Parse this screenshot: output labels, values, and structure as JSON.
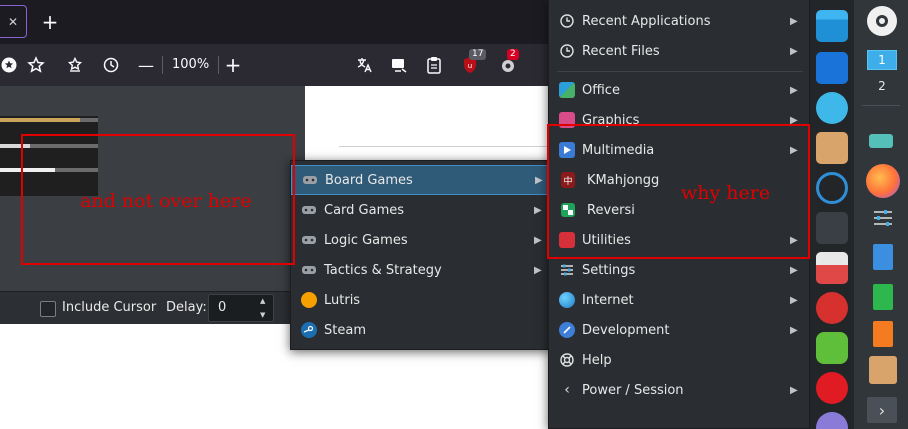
{
  "browser": {
    "zoom_level": "100%",
    "new_tab_label": "+",
    "tab_close_label": "✕",
    "extension_badge_1": "17",
    "extension_badge_2": "2",
    "zoom_out_label": "—",
    "zoom_in_label": "+"
  },
  "screenshot_tool": {
    "include_cursor_label": "Include Cursor",
    "delay_label": "Delay:",
    "delay_value": "0"
  },
  "games_menu": {
    "items": [
      {
        "label": "Board Games",
        "icon": "board-games-icon",
        "has_submenu": true,
        "highlighted": true
      },
      {
        "label": "Card Games",
        "icon": "card-games-icon",
        "has_submenu": true
      },
      {
        "label": "Logic Games",
        "icon": "logic-games-icon",
        "has_submenu": true
      },
      {
        "label": "Tactics & Strategy",
        "icon": "tactics-icon",
        "has_submenu": true
      },
      {
        "label": "Lutris",
        "icon": "lutris-icon",
        "has_submenu": false
      },
      {
        "label": "Steam",
        "icon": "steam-icon",
        "has_submenu": false
      }
    ]
  },
  "main_menu": {
    "items": [
      {
        "label": "Recent Applications",
        "icon": "clock-icon",
        "has_submenu": true
      },
      {
        "label": "Recent Files",
        "icon": "clock-icon",
        "has_submenu": true
      },
      {
        "label": "Office",
        "icon": "office-icon",
        "has_submenu": true
      },
      {
        "label": "Graphics",
        "icon": "graphics-icon",
        "has_submenu": true
      },
      {
        "label": "Multimedia",
        "icon": "multimedia-icon",
        "has_submenu": true
      },
      {
        "label": "KMahjongg",
        "icon": "kmahjongg-icon",
        "has_submenu": false
      },
      {
        "label": "Reversi",
        "icon": "reversi-icon",
        "has_submenu": false
      },
      {
        "label": "Utilities",
        "icon": "utilities-icon",
        "has_submenu": true
      },
      {
        "label": "Settings",
        "icon": "settings-icon",
        "has_submenu": true
      },
      {
        "label": "Internet",
        "icon": "internet-icon",
        "has_submenu": true
      },
      {
        "label": "Development",
        "icon": "development-icon",
        "has_submenu": true
      },
      {
        "label": "Help",
        "icon": "help-icon",
        "has_submenu": false
      },
      {
        "label": "Power / Session",
        "icon": "power-icon",
        "has_submenu": true
      }
    ]
  },
  "panel": {
    "desktop_1": "1",
    "desktop_2": "2"
  },
  "annotations": {
    "left_note": "and not over here",
    "right_note": "why here"
  },
  "colors": {
    "annotation_red": "#e00000",
    "menu_bg": "#2a2e32",
    "highlight_bg": "#2f5a78",
    "highlight_border": "#3d8fc4"
  }
}
